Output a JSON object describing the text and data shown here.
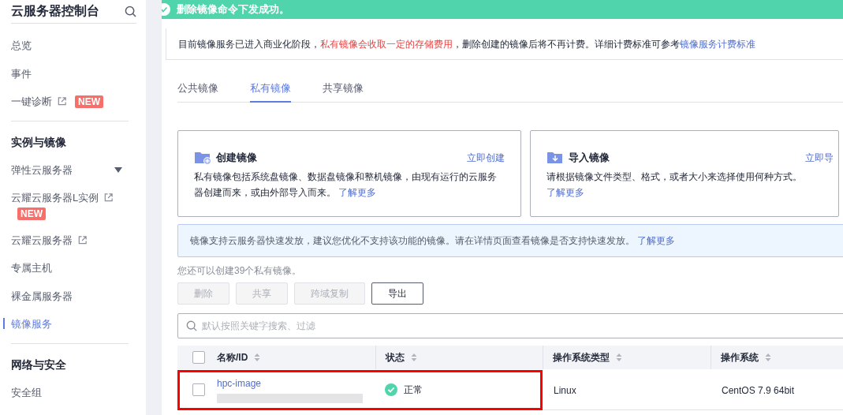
{
  "sidebar": {
    "title": "云服务器控制台",
    "groups": [
      {
        "items": [
          {
            "label": "总览",
            "selected": false
          },
          {
            "label": "事件",
            "selected": false
          },
          {
            "label": "一键诊断",
            "selected": false,
            "external": true,
            "badge": "NEW"
          }
        ]
      },
      {
        "heading": "实例与镜像",
        "items": [
          {
            "label": "弹性云服务器",
            "selected": false,
            "expandable": true
          },
          {
            "label": "云耀云服务器L实例",
            "selected": false,
            "external": true,
            "badge": "NEW"
          },
          {
            "label": "云耀云服务器",
            "selected": false,
            "external": true
          },
          {
            "label": "专属主机",
            "selected": false
          },
          {
            "label": "裸金属服务器",
            "selected": false
          },
          {
            "label": "镜像服务",
            "selected": true
          }
        ]
      },
      {
        "heading": "网络与安全",
        "items": [
          {
            "label": "安全组",
            "selected": false
          }
        ]
      }
    ]
  },
  "toast": {
    "message": "删除镜像命令下发成功。"
  },
  "notice": {
    "before": "目前镜像服务已进入商业化阶段，",
    "warning": "私有镜像会收取一定的存储费用",
    "after": "，删除创建的镜像后将不再计费。详细计费标准可参考",
    "link": "镜像服务计费标准"
  },
  "tabs": [
    {
      "label": "公共镜像",
      "selected": false
    },
    {
      "label": "私有镜像",
      "selected": true
    },
    {
      "label": "共享镜像",
      "selected": false
    }
  ],
  "cards": [
    {
      "kind": "create",
      "title": "创建镜像",
      "action": "立即创建",
      "description": "私有镜像包括系统盘镜像、数据盘镜像和整机镜像，由现有运行的云服务器创建而来，或由外部导入而来。",
      "link": "了解更多"
    },
    {
      "kind": "import",
      "title": "导入镜像",
      "action": "立即导",
      "description": "请根据镜像文件类型、格式，或者大小来选择使用何种方式。",
      "link": "了解更多"
    }
  ],
  "info": {
    "text": "镜像支持云服务器快速发放，建议您优化不支持该功能的镜像。请在详情页面查看镜像是否支持快速发放。",
    "link": "了解更多"
  },
  "quota": "您还可以创建39个私有镜像。",
  "buttons": [
    {
      "label": "删除",
      "disabled": true
    },
    {
      "label": "共享",
      "disabled": true
    },
    {
      "label": "跨域复制",
      "disabled": true
    },
    {
      "label": "导出",
      "disabled": false
    }
  ],
  "search": {
    "placeholder": "默认按照关键字搜索、过滤"
  },
  "table": {
    "select_all": {
      "checked": false
    },
    "columns": [
      "名称/ID",
      "状态",
      "操作系统类型",
      "操作系统"
    ],
    "rows": [
      {
        "checked": false,
        "highlighted": true,
        "name": "hpc-image",
        "status": "正常",
        "os_type": "Linux",
        "os": "CentOS 7.9 64bit"
      }
    ]
  }
}
